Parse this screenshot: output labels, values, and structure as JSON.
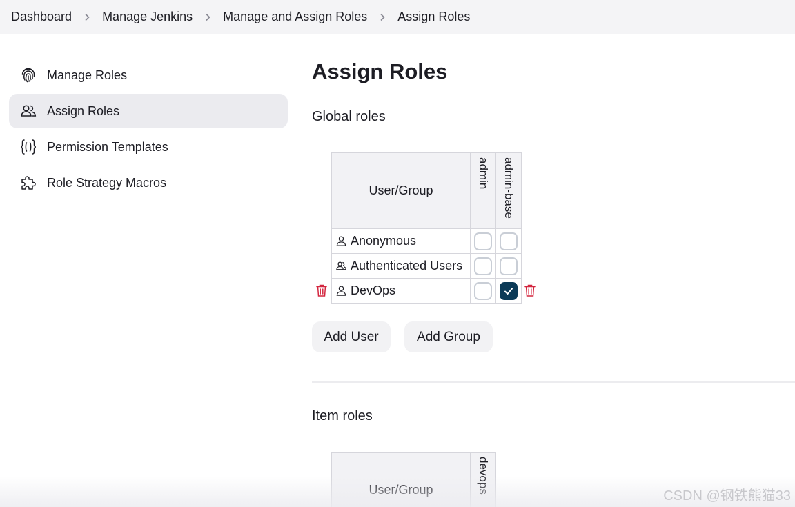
{
  "breadcrumb": {
    "items": [
      "Dashboard",
      "Manage Jenkins",
      "Manage and Assign Roles",
      "Assign Roles"
    ]
  },
  "sidebar": {
    "items": [
      {
        "label": "Manage Roles",
        "icon": "fingerprint-icon",
        "active": false
      },
      {
        "label": "Assign Roles",
        "icon": "users-icon",
        "active": true
      },
      {
        "label": "Permission Templates",
        "icon": "braces-icon",
        "active": false
      },
      {
        "label": "Role Strategy Macros",
        "icon": "puzzle-icon",
        "active": false
      }
    ]
  },
  "main": {
    "title": "Assign Roles",
    "global_section": {
      "title": "Global roles",
      "user_group_header": "User/Group",
      "roles": [
        "admin",
        "admin-base"
      ],
      "rows": [
        {
          "name": "Anonymous",
          "icon": "user-icon",
          "checks": [
            false,
            false
          ],
          "deletable": false
        },
        {
          "name": "Authenticated Users",
          "icon": "users-icon",
          "checks": [
            false,
            false
          ],
          "deletable": false
        },
        {
          "name": "DevOps",
          "icon": "user-icon",
          "checks": [
            false,
            true
          ],
          "deletable": true
        }
      ]
    },
    "add_user_label": "Add User",
    "add_group_label": "Add Group",
    "item_section": {
      "title": "Item roles",
      "user_group_header": "User/Group",
      "roles": [
        "devops"
      ]
    }
  },
  "colors": {
    "checked": "#0b3a57",
    "delete": "#d3263f",
    "active_bg": "#ebebef"
  },
  "watermark": "CSDN @钢铁熊猫33"
}
